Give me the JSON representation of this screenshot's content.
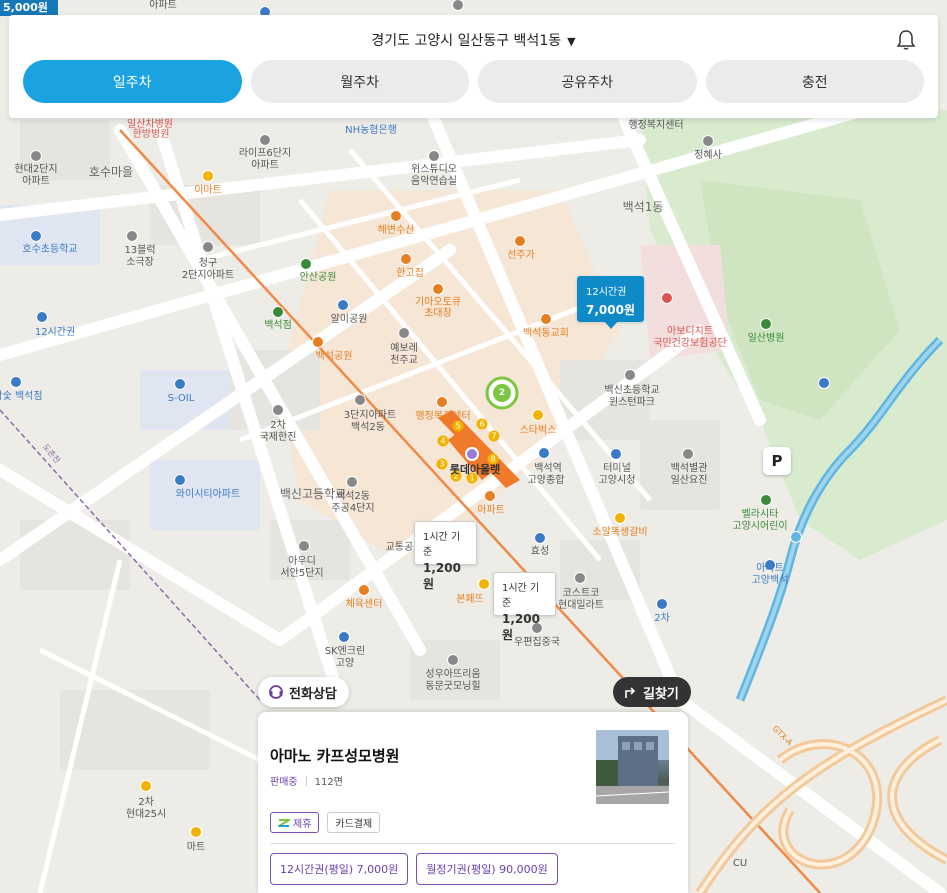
{
  "corner_badge": "5,000원",
  "header": {
    "location": "경기도 고양시 일산동구 백석1동",
    "tabs": [
      {
        "label": "일주차",
        "active": true
      },
      {
        "label": "월주차",
        "active": false
      },
      {
        "label": "공유주차",
        "active": false
      },
      {
        "label": "충전",
        "active": false
      }
    ]
  },
  "callouts": [
    {
      "label": "12시간권",
      "price": "7,000원"
    },
    {
      "label": "1시간 기준",
      "price": "1,200원"
    },
    {
      "label": "1시간 기준",
      "price": "1,200원"
    }
  ],
  "map_labels": [
    "아파트",
    "일산차병원",
    "한방병원",
    "NH농협은행",
    "행정복지센터",
    "정혜사",
    "현대2단지",
    "아파트",
    "호수마을",
    "라이프6단지",
    "아파트",
    "위스튜디오",
    "음악연습실",
    "이마트",
    "백석1동",
    "해변수산",
    "선주가",
    "13블럭",
    "소극장",
    "청구",
    "2단지아파트",
    "호수초등학교",
    "안산공원",
    "한고집",
    "12시간권",
    "기아오토큐",
    "초대창",
    "백석점",
    "알미공원",
    "예보레",
    "천주교",
    "백석동교회",
    "아보디치트",
    "국민건강보험공단",
    "일산병원",
    "백석공원",
    "참숯 백석점",
    "S-OIL",
    "백신초등학교",
    "윈스턴파크",
    "2차",
    "국제한진",
    "3단지아파트",
    "백석2동",
    "행정복지센터",
    "스타벅스",
    "롯데아울렛",
    "백석역",
    "고양종합",
    "터미널",
    "고양시청",
    "백석별관",
    "일산요진",
    "와이시티아파트",
    "백신고등학교",
    "백석2동",
    "주공4단지",
    "아파트",
    "소말똑생갈비",
    "벨라시타",
    "고양시어린이",
    "교통공원",
    "효성",
    "아우디",
    "서안5단지",
    "아파트",
    "고양백석",
    "체육센터",
    "본페뜨",
    "코스트코",
    "현대밀라트",
    "2차",
    "SK엔크린",
    "고양",
    "우편집중국",
    "성우아뜨리움",
    "동문굿모닝힐",
    "2차",
    "현대25시",
    "마트",
    "CU",
    "도촌천",
    "GTX-A",
    "3호선"
  ],
  "parking_marker": "P",
  "cluster_count": "2",
  "station_exits": [
    "1",
    "2",
    "3",
    "4",
    "5",
    "6",
    "7",
    "8"
  ],
  "actions": {
    "call": "전화상담",
    "navigate": "길찾기"
  },
  "card": {
    "title": "아마노 카프성모병원",
    "type": "판매중",
    "spaces": "112면",
    "chips": [
      "제휴",
      "카드결제"
    ],
    "tickets": [
      "12시간권(평일) 7,000원",
      "월정기권(평일) 90,000원"
    ]
  }
}
